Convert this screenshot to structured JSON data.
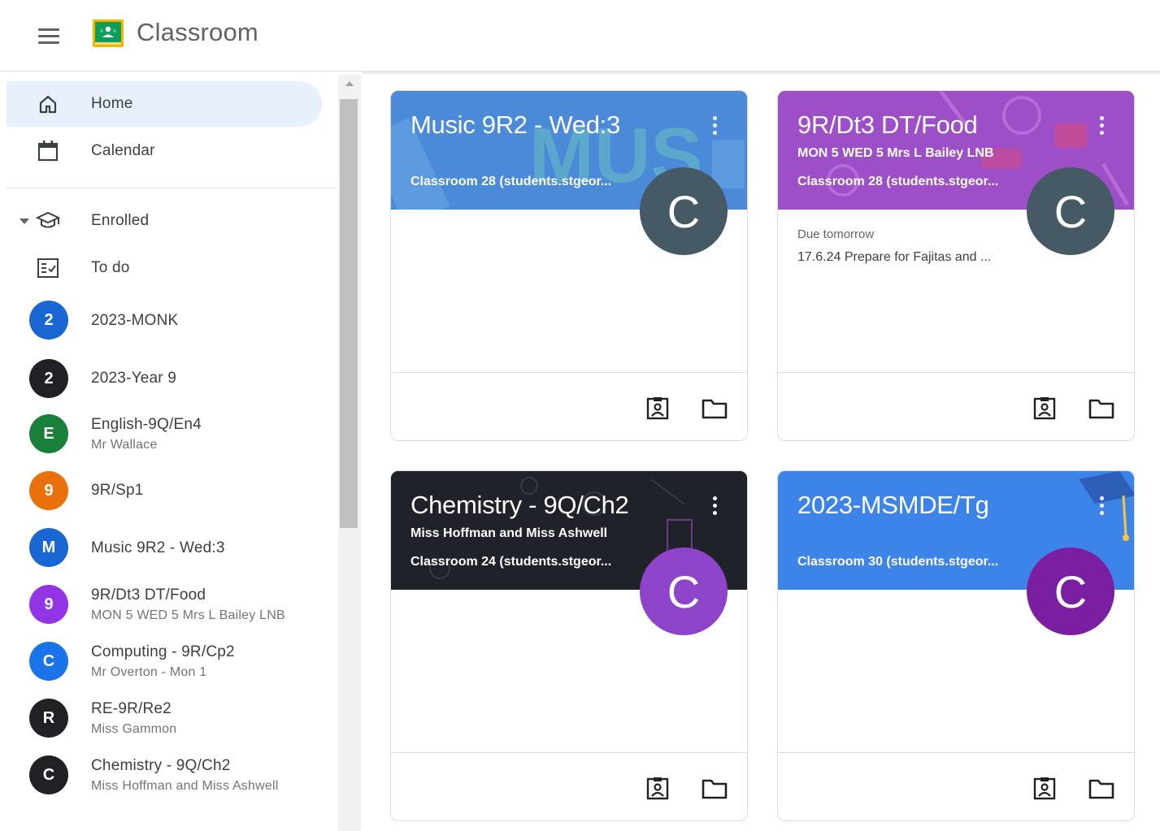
{
  "app": {
    "title": "Classroom"
  },
  "nav": {
    "home": "Home",
    "calendar": "Calendar",
    "enrolled": "Enrolled",
    "todo": "To do"
  },
  "courses": [
    {
      "initial": "2",
      "name": "2023-MONK",
      "sub": "",
      "color": "#1967d2"
    },
    {
      "initial": "2",
      "name": "2023-Year 9",
      "sub": "",
      "color": "#202124"
    },
    {
      "initial": "E",
      "name": "English-9Q/En4",
      "sub": "Mr Wallace",
      "color": "#188038"
    },
    {
      "initial": "9",
      "name": "9R/Sp1",
      "sub": "",
      "color": "#e8710a"
    },
    {
      "initial": "M",
      "name": "Music 9R2 - Wed:3",
      "sub": "",
      "color": "#1967d2"
    },
    {
      "initial": "9",
      "name": "9R/Dt3 DT/Food",
      "sub": "MON 5 WED 5 Mrs L Bailey LNB",
      "color": "#9334e6"
    },
    {
      "initial": "C",
      "name": "Computing - 9R/Cp2",
      "sub": "Mr Overton - Mon 1",
      "color": "#1a73e8"
    },
    {
      "initial": "R",
      "name": "RE-9R/Re2",
      "sub": "Miss Gammon",
      "color": "#202124"
    },
    {
      "initial": "C",
      "name": "Chemistry - 9Q/Ch2",
      "sub": "Miss Hoffman and Miss Ashwell",
      "color": "#202124"
    }
  ],
  "cards": [
    {
      "title": "Music 9R2 - Wed:3",
      "teacher": "",
      "room": "Classroom 28 (students.stgeor...",
      "avatar": "C",
      "avatar_color": "#455a64",
      "header_color": "#4a8ad8",
      "due_label": "",
      "due_item": ""
    },
    {
      "title": "9R/Dt3 DT/Food",
      "teacher": "MON 5 WED 5 Mrs L Bailey LNB",
      "room": "Classroom 28 (students.stgeor...",
      "avatar": "C",
      "avatar_color": "#455a64",
      "header_color": "#9c4fc6",
      "due_label": "Due tomorrow",
      "due_item": "17.6.24 Prepare for Fajitas and ..."
    },
    {
      "title": "Chemistry - 9Q/Ch2",
      "teacher": "Miss Hoffman and Miss Ashwell",
      "room": "Classroom 24 (students.stgeor...",
      "avatar": "C",
      "avatar_color": "#8e44c9",
      "header_color": "#1f2329",
      "due_label": "",
      "due_item": ""
    },
    {
      "title": "2023-MSMDE/Tg",
      "teacher": "",
      "room": "Classroom 30 (students.stgeor...",
      "avatar": "C",
      "avatar_color": "#7b1fa2",
      "header_color": "#3c84e8",
      "due_label": "",
      "due_item": ""
    }
  ]
}
